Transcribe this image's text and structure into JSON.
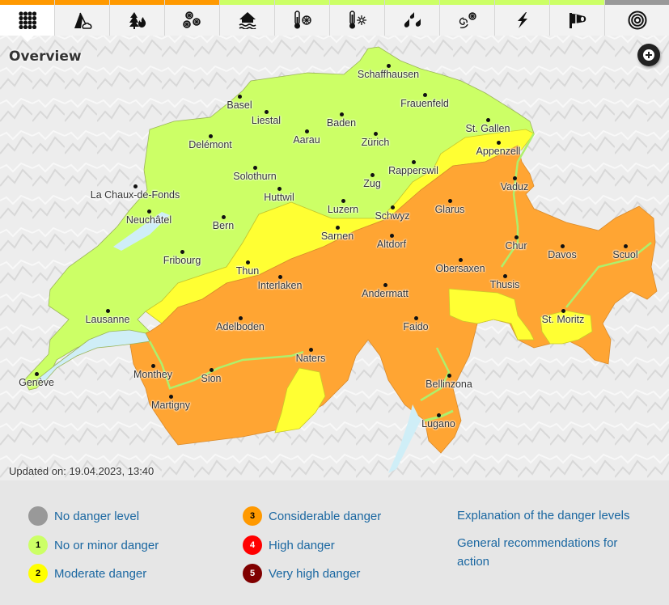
{
  "tabs": [
    {
      "id": "overview",
      "icon": "grid-icon",
      "status_color": "#ff9900",
      "active": true
    },
    {
      "id": "landslide",
      "icon": "landslide-icon",
      "status_color": "#ff9900",
      "active": false
    },
    {
      "id": "forest-fire",
      "icon": "forest-fire-icon",
      "status_color": "#ff9900",
      "active": false
    },
    {
      "id": "avalanche",
      "icon": "snowflakes-icon",
      "status_color": "#ff9900",
      "active": false
    },
    {
      "id": "flood",
      "icon": "flooded-house-icon",
      "status_color": "#ccff66",
      "active": false
    },
    {
      "id": "frost",
      "icon": "thermometer-snowflake-icon",
      "status_color": "#ccff66",
      "active": false
    },
    {
      "id": "heat",
      "icon": "thermometer-sun-icon",
      "status_color": "#ccff66",
      "active": false
    },
    {
      "id": "rain",
      "icon": "raindrops-icon",
      "status_color": "#ccff66",
      "active": false
    },
    {
      "id": "snow",
      "icon": "wind-snow-icon",
      "status_color": "#ccff66",
      "active": false
    },
    {
      "id": "thunderstorm",
      "icon": "lightning-icon",
      "status_color": "#ccff66",
      "active": false
    },
    {
      "id": "wind",
      "icon": "windsock-icon",
      "status_color": "#ccff66",
      "active": false
    },
    {
      "id": "earthquake",
      "icon": "target-rings-icon",
      "status_color": "#999999",
      "active": false
    }
  ],
  "map": {
    "title": "Overview",
    "zoom_button_icon": "zoom-plus-icon",
    "updated": "Updated on: 19.04.2023, 13:40",
    "cities": [
      "Schaffhausen",
      "Basel",
      "Frauenfeld",
      "Liestal",
      "Baden",
      "St. Gallen",
      "Delémont",
      "Aarau",
      "Zürich",
      "Appenzell",
      "Solothurn",
      "Rapperswil",
      "La Chaux-de-Fonds",
      "Huttwil",
      "Zug",
      "Vaduz",
      "Luzern",
      "Glarus",
      "Neuchâtel",
      "Schwyz",
      "Bern",
      "Sarnen",
      "Altdorf",
      "Chur",
      "Davos",
      "Scuol",
      "Fribourg",
      "Thun",
      "Obersaxen",
      "Interlaken",
      "Thusis",
      "Andermatt",
      "Lausanne",
      "St. Moritz",
      "Adelboden",
      "Faido",
      "Naters",
      "Monthey",
      "Sion",
      "Genève",
      "Bellinzona",
      "Martigny",
      "Lugano"
    ]
  },
  "legend": {
    "levels": [
      {
        "num": "",
        "label": "No danger level",
        "color": "#999999",
        "text_color": "#000"
      },
      {
        "num": "1",
        "label": "No or minor danger",
        "color": "#ccff66",
        "text_color": "#000"
      },
      {
        "num": "2",
        "label": "Moderate danger",
        "color": "#ffff00",
        "text_color": "#000"
      },
      {
        "num": "3",
        "label": "Considerable danger",
        "color": "#ff9900",
        "text_color": "#000"
      },
      {
        "num": "4",
        "label": "High danger",
        "color": "#ff0000",
        "text_color": "#fff"
      },
      {
        "num": "5",
        "label": "Very high danger",
        "color": "#800000",
        "text_color": "#fff"
      }
    ],
    "links": {
      "explanation": "Explanation of the danger levels",
      "recommendations": "General recommendations for action"
    }
  }
}
